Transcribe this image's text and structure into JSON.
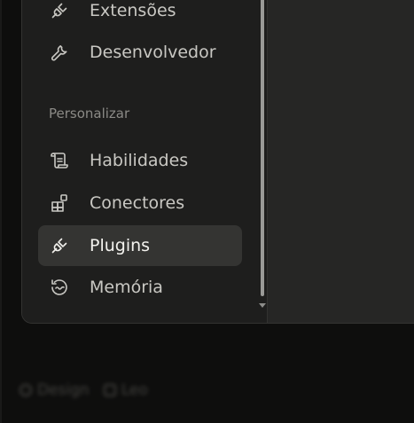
{
  "colors": {
    "window_bg": "#1e1e1d",
    "main_pane_bg": "#262625",
    "active_item_bg": "#343432",
    "text_primary": "#c9c8c3",
    "text_active": "#f3f2ee",
    "text_muted": "#8b8a86"
  },
  "sidebar": {
    "items_top": [
      {
        "label": "Extensões",
        "icon": "plug-icon"
      },
      {
        "label": "Desenvolvedor",
        "icon": "wrench-icon"
      }
    ],
    "section_title": "Personalizar",
    "items": [
      {
        "label": "Habilidades",
        "icon": "scroll-icon",
        "active": false
      },
      {
        "label": "Conectores",
        "icon": "blocks-icon",
        "active": false
      },
      {
        "label": "Plugins",
        "icon": "plug-icon",
        "active": true
      },
      {
        "label": "Memória",
        "icon": "history-icon",
        "active": false
      }
    ]
  },
  "footer": {
    "left_label": "Design",
    "right_label": "Leo"
  }
}
